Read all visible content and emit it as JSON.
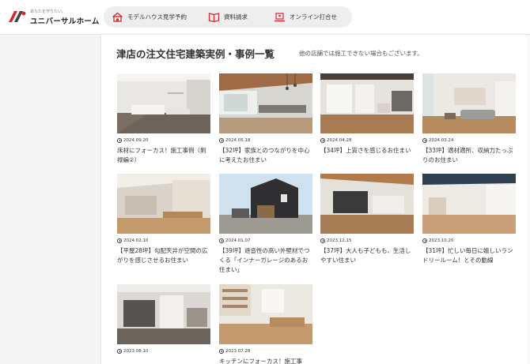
{
  "logo": {
    "tagline": "あなたを守りたい。",
    "name": "ユニバーサルホーム"
  },
  "nav": {
    "items": [
      {
        "label": "モデルハウス見学予約",
        "icon": "house-icon"
      },
      {
        "label": "資料請求",
        "icon": "book-icon"
      },
      {
        "label": "オンライン打合せ",
        "icon": "laptop-icon"
      }
    ]
  },
  "main": {
    "title": "津店の注文住宅建築実例・事例一覧",
    "note": "他の店舗では施工できない場合もございます。"
  },
  "cards": [
    {
      "date": "2024.09.20",
      "title": "床材にフォーカス！施工事例（剣禄編②）"
    },
    {
      "date": "2024.05.18",
      "title": "【32坪】家族とのつながりを中心に考えたお住まい"
    },
    {
      "date": "2024.04.28",
      "title": "【34坪】上質さを感じるお住まい"
    },
    {
      "date": "2024.03.24",
      "title": "【33坪】適材適所、収納力たっぷりのお住まい"
    },
    {
      "date": "2024.02.10",
      "title": "【平屋28坪】勾配天井が空間の広がりを感じさせるお住まい"
    },
    {
      "date": "2024.01.07",
      "title": "【39坪】遮音性の高い外壁材でつくる「インナーガレージのあるお住まい」"
    },
    {
      "date": "2023.12.15",
      "title": "【37坪】大人も子どもも、生活しやすい住まい"
    },
    {
      "date": "2023.10.20",
      "title": "【31坪】忙しい毎日に嬉しいランドリールーム！とその動線"
    },
    {
      "date": "2023.08.10",
      "title": ""
    },
    {
      "date": "2023.07.28",
      "title": "キッチンにフォーカス！施工事"
    }
  ]
}
